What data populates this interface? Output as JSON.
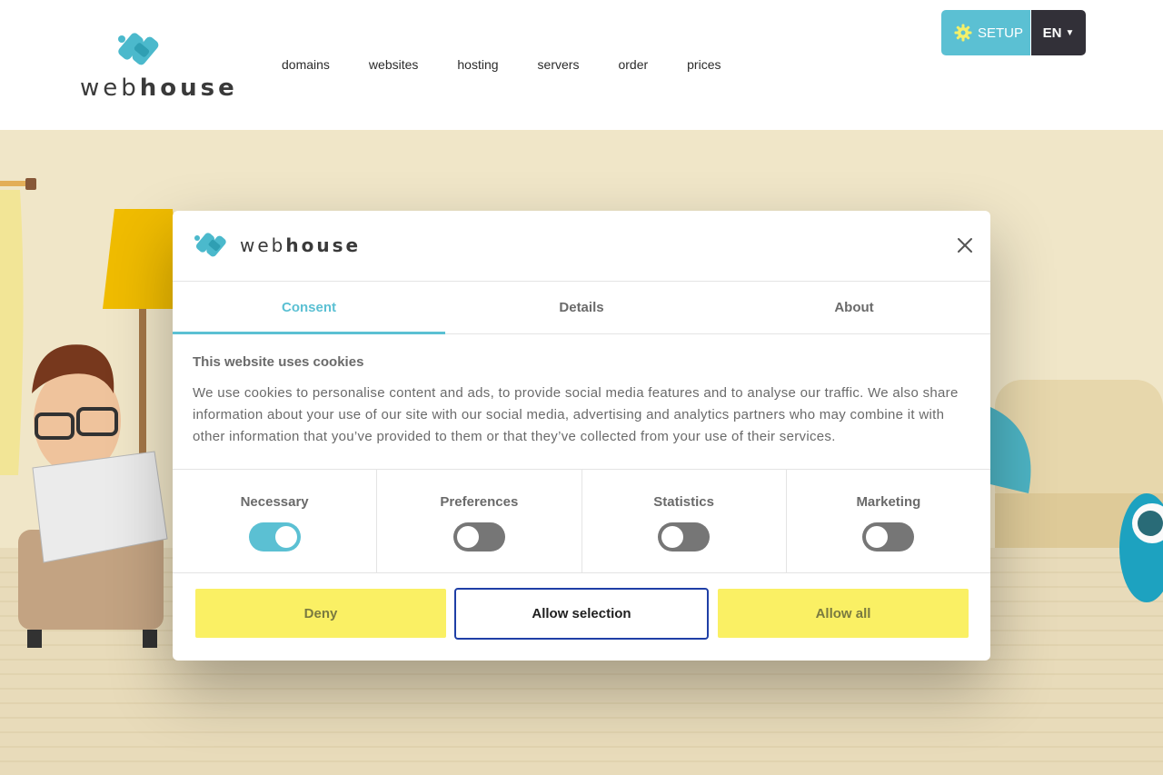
{
  "header": {
    "logo_text_a": "web",
    "logo_text_b": "house",
    "nav": [
      "domains",
      "websites",
      "hosting",
      "servers",
      "order",
      "prices"
    ],
    "setup_label": "SETUP",
    "lang_label": "EN"
  },
  "modal": {
    "logo_text_a": "web",
    "logo_text_b": "house",
    "tabs": [
      "Consent",
      "Details",
      "About"
    ],
    "heading": "This website uses cookies",
    "body": "We use cookies to personalise content and ads, to provide social media features and to analyse our traffic. We also share information about your use of our site with our social media, advertising and analytics partners who may combine it with other information that you’ve provided to them or that they’ve collected from your use of their services.",
    "toggles": [
      {
        "label": "Necessary",
        "on": true
      },
      {
        "label": "Preferences",
        "on": false
      },
      {
        "label": "Statistics",
        "on": false
      },
      {
        "label": "Marketing",
        "on": false
      }
    ],
    "buttons": {
      "deny": "Deny",
      "allow_selection": "Allow selection",
      "allow_all": "Allow all"
    }
  },
  "colors": {
    "accent": "#5bc0d3",
    "button_yellow": "#faf064",
    "dark": "#323038",
    "hero_bg": "#f5ebcc"
  }
}
